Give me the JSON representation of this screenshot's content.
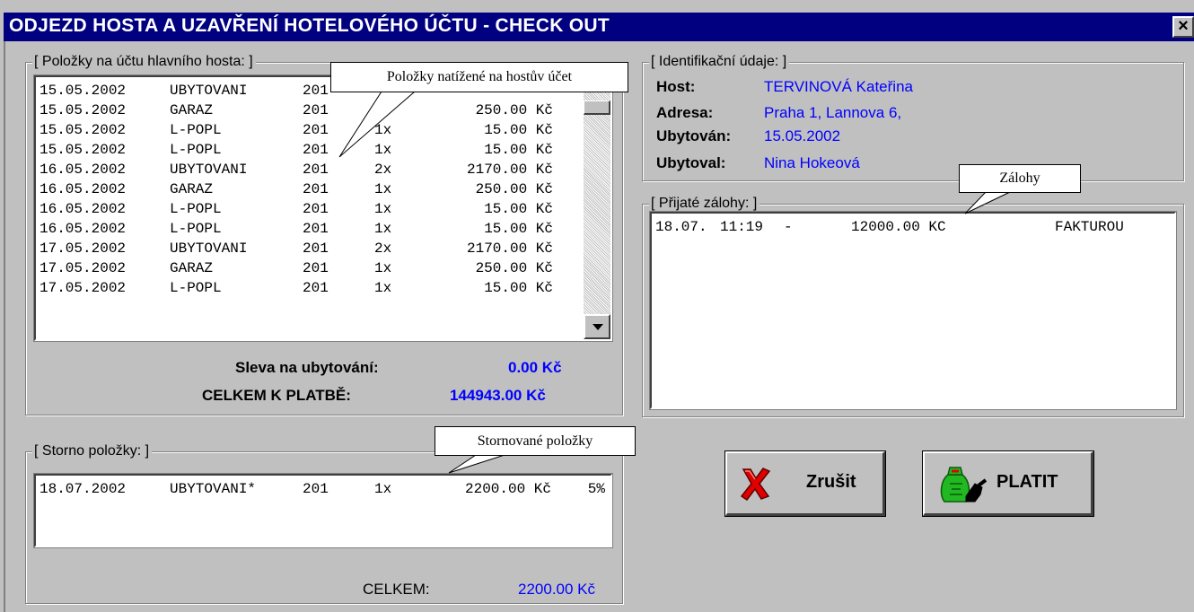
{
  "window": {
    "title": "ODJEZD HOSTA A UZAVŘENÍ HOTELOVÉHO ÚČTU  -  CHECK OUT",
    "close_glyph": "×"
  },
  "account": {
    "legend": "[ Položky na účtu hlavního hosta: ]",
    "rows": [
      {
        "date": "15.05.2002",
        "item": "UBYTOVANI",
        "room": "201",
        "qty": "",
        "price": ""
      },
      {
        "date": "15.05.2002",
        "item": "GARAZ",
        "room": "201",
        "qty": "",
        "price": "250.00 Kč"
      },
      {
        "date": "15.05.2002",
        "item": "L-POPL",
        "room": "201",
        "qty": "1x",
        "price": "15.00 Kč"
      },
      {
        "date": "15.05.2002",
        "item": "L-POPL",
        "room": "201",
        "qty": "1x",
        "price": "15.00 Kč"
      },
      {
        "date": "16.05.2002",
        "item": "UBYTOVANI",
        "room": "201",
        "qty": "2x",
        "price": "2170.00 Kč"
      },
      {
        "date": "16.05.2002",
        "item": "GARAZ",
        "room": "201",
        "qty": "1x",
        "price": "250.00 Kč"
      },
      {
        "date": "16.05.2002",
        "item": "L-POPL",
        "room": "201",
        "qty": "1x",
        "price": "15.00 Kč"
      },
      {
        "date": "16.05.2002",
        "item": "L-POPL",
        "room": "201",
        "qty": "1x",
        "price": "15.00 Kč"
      },
      {
        "date": "17.05.2002",
        "item": "UBYTOVANI",
        "room": "201",
        "qty": "2x",
        "price": "2170.00 Kč"
      },
      {
        "date": "17.05.2002",
        "item": "GARAZ",
        "room": "201",
        "qty": "1x",
        "price": "250.00 Kč"
      },
      {
        "date": "17.05.2002",
        "item": "L-POPL",
        "room": "201",
        "qty": "1x",
        "price": "15.00 Kč"
      }
    ],
    "discount_label": "Sleva na ubytování:",
    "discount_value": "0.00 Kč",
    "total_label": "CELKEM K PLATBĚ:",
    "total_value": "144943.00 Kč"
  },
  "storno": {
    "legend": "[ Storno položky: ]",
    "rows": [
      {
        "date": "18.07.2002",
        "item": "UBYTOVANI*",
        "room": "201",
        "qty": "1x",
        "price": "2200.00 Kč",
        "pct": "5%"
      }
    ],
    "total_label": "CELKEM:",
    "total_value": "2200.00 Kč"
  },
  "identification": {
    "legend": "[ Identifikační údaje: ]",
    "host_label": "Host:",
    "host_value": "TERVINOVÁ Kateřina",
    "address_label": "Adresa:",
    "address_value": "Praha 1, Lannova 6,",
    "checkin_label": "Ubytován:",
    "checkin_value": "15.05.2002",
    "checkedin_by_label": "Ubytoval:",
    "checkedin_by_value": "Nina Hokeová"
  },
  "deposits": {
    "legend": "[ Přijaté zálohy: ]",
    "rows": [
      {
        "date": "18.07.",
        "time": "11:19",
        "dash": "-",
        "amount": "12000.00 KC",
        "method": "FAKTUROU"
      }
    ]
  },
  "buttons": {
    "cancel_label": "Zrušit",
    "pay_label": "PLATIT"
  },
  "callouts": {
    "account_items": "Položky natížené na hostův účet",
    "deposits": "Zálohy",
    "storno_items": "Stornované položky"
  },
  "colors": {
    "title_bar": "#000080",
    "value_blue": "#0000ff",
    "window_bg": "#c0c0c0"
  },
  "icons": {
    "cancel": "red-x-icon",
    "pay": "money-bag-hand-icon",
    "scroll_down": "chevron-down-icon"
  }
}
